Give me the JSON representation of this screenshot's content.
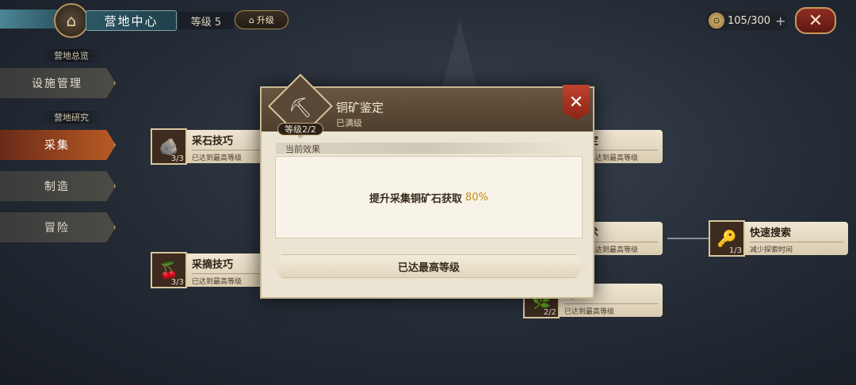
{
  "header": {
    "title": "营地中心",
    "level": "等级 5",
    "upgrade_label": "升级",
    "currency": "105/300",
    "plus": "+",
    "close": "✕"
  },
  "sidebar": {
    "section1": "营地总览",
    "section2": "营地研究",
    "items": [
      {
        "label": "设施管理"
      },
      {
        "label": "采集"
      },
      {
        "label": "制造"
      },
      {
        "label": "冒险"
      }
    ]
  },
  "tree": {
    "nodes": [
      {
        "title": "采石技巧",
        "sub": "已达到最高等级",
        "count": "3/3",
        "icon": "stone-icon"
      },
      {
        "title": "采摘技巧",
        "sub": "已达到最高等级",
        "count": "3/3",
        "icon": "berry-icon"
      },
      {
        "title": "定",
        "sub": "已达到最高等级",
        "count": "",
        "icon": ""
      },
      {
        "title": "术",
        "sub": "已达到最高等级",
        "count": "",
        "icon": ""
      },
      {
        "title": "定",
        "sub": "已达到最高等级",
        "count": "2/2",
        "icon": "herb-icon"
      },
      {
        "title": "快速搜索",
        "sub": "减少探索时间",
        "count": "1/3",
        "icon": "key-icon"
      }
    ]
  },
  "modal": {
    "title": "铜矿鉴定",
    "status": "已满级",
    "level_badge": "等级2/2",
    "close": "✕",
    "effect_label": "当前效果",
    "effect_text": "提升采集铜矿石获取",
    "effect_value": "80%",
    "max_button": "已达最高等级"
  },
  "colors": {
    "accent_gold": "#c08a1a",
    "active_tab": "#b85a24",
    "close_red": "#8e2d22"
  }
}
